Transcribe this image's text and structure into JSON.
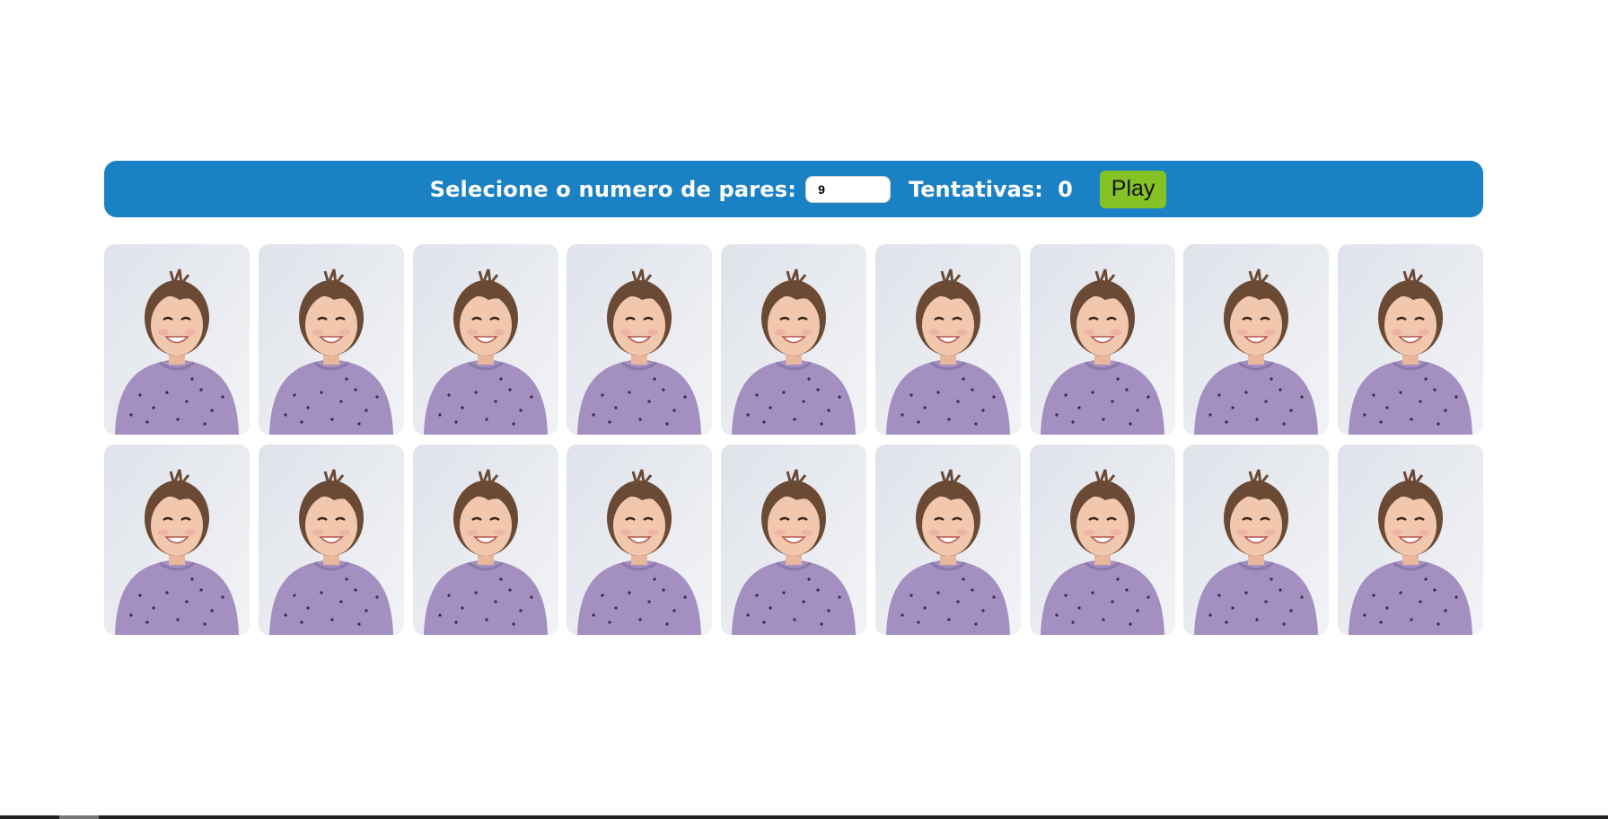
{
  "header": {
    "pairs_label": "Selecione o numero de pares:",
    "pairs_value": "9",
    "attempts_label": "Tentativas:",
    "attempts_value": "0",
    "play_label": "Play"
  },
  "colors": {
    "header_bg": "#1a82c4",
    "play_bg": "#84c225",
    "card_bg": "#e6e8ee",
    "shirt": "#a48fc1",
    "hair": "#6b4a35",
    "skin": "#f1c7ae"
  },
  "board": {
    "card_image": "child-portrait",
    "card_count": 18
  }
}
